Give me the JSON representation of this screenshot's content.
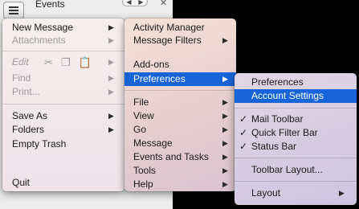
{
  "header": {
    "tab_title": "Events",
    "nav_left": "◀",
    "nav_right": "▶",
    "close": "✕"
  },
  "main_menu": {
    "new_message": "New Message",
    "attachments": "Attachments",
    "edit": "Edit",
    "find": "Find",
    "print": "Print...",
    "save_as": "Save As",
    "folders": "Folders",
    "empty_trash": "Empty Trash",
    "quit": "Quit",
    "edit_icons": [
      "cut-icon",
      "copy-icon",
      "paste-icon"
    ]
  },
  "tools_menu": {
    "activity_manager": "Activity Manager",
    "message_filters": "Message Filters",
    "add_ons": "Add-ons",
    "preferences": "Preferences",
    "file": "File",
    "view": "View",
    "go": "Go",
    "message": "Message",
    "events_and_tasks": "Events and Tasks",
    "tools": "Tools",
    "help": "Help"
  },
  "preferences_menu": {
    "preferences": "Preferences",
    "account_settings": "Account Settings",
    "mail_toolbar": "Mail Toolbar",
    "quick_filter_bar": "Quick Filter Bar",
    "status_bar": "Status Bar",
    "toolbar_layout": "Toolbar Layout...",
    "layout": "Layout",
    "check": "✓"
  },
  "colors": {
    "highlight": "#1764d8",
    "disabled_text": "#9e9a9c"
  }
}
